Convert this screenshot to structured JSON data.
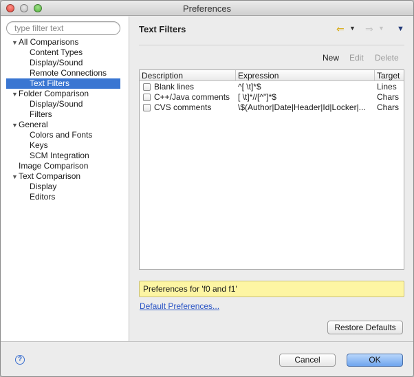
{
  "window": {
    "title": "Preferences"
  },
  "filter": {
    "placeholder": "type filter text"
  },
  "tree": [
    {
      "label": "All Comparisons",
      "level": 0,
      "expanded": true
    },
    {
      "label": "Content Types",
      "level": 1
    },
    {
      "label": "Display/Sound",
      "level": 1
    },
    {
      "label": "Remote Connections",
      "level": 1
    },
    {
      "label": "Text Filters",
      "level": 1,
      "selected": true
    },
    {
      "label": "Folder Comparison",
      "level": 0,
      "expanded": true
    },
    {
      "label": "Display/Sound",
      "level": 1
    },
    {
      "label": "Filters",
      "level": 1
    },
    {
      "label": "General",
      "level": 0,
      "expanded": true
    },
    {
      "label": "Colors and Fonts",
      "level": 1
    },
    {
      "label": "Keys",
      "level": 1
    },
    {
      "label": "SCM Integration",
      "level": 1
    },
    {
      "label": "Image Comparison",
      "level": 0
    },
    {
      "label": "Text Comparison",
      "level": 0,
      "expanded": true
    },
    {
      "label": "Display",
      "level": 1
    },
    {
      "label": "Editors",
      "level": 1
    }
  ],
  "page": {
    "title": "Text Filters",
    "toolbar": {
      "new": "New",
      "edit": "Edit",
      "delete": "Delete"
    },
    "table": {
      "columns": [
        "Description",
        "Expression",
        "Target"
      ],
      "rows": [
        {
          "description": "Blank lines",
          "expression": "^[ \\t]*$",
          "target": "Lines",
          "checked": false
        },
        {
          "description": "C++/Java comments",
          "expression": "[ \\t]*//[^\"]*$",
          "target": "Chars",
          "checked": false
        },
        {
          "description": "CVS comments",
          "expression": "\\$(Author|Date|Header|Id|Locker|...",
          "target": "Chars",
          "checked": false
        }
      ]
    },
    "notice": "Preferences for 'f0 and f1'",
    "default_link": "Default Preferences...",
    "restore_label": "Restore Defaults"
  },
  "footer": {
    "help_glyph": "?",
    "cancel": "Cancel",
    "ok": "OK"
  },
  "colors": {
    "selection": "#3a76d2",
    "notice_bg": "#fdf5a3",
    "link": "#2b55c5",
    "ok_button": "#6fa5ee"
  }
}
